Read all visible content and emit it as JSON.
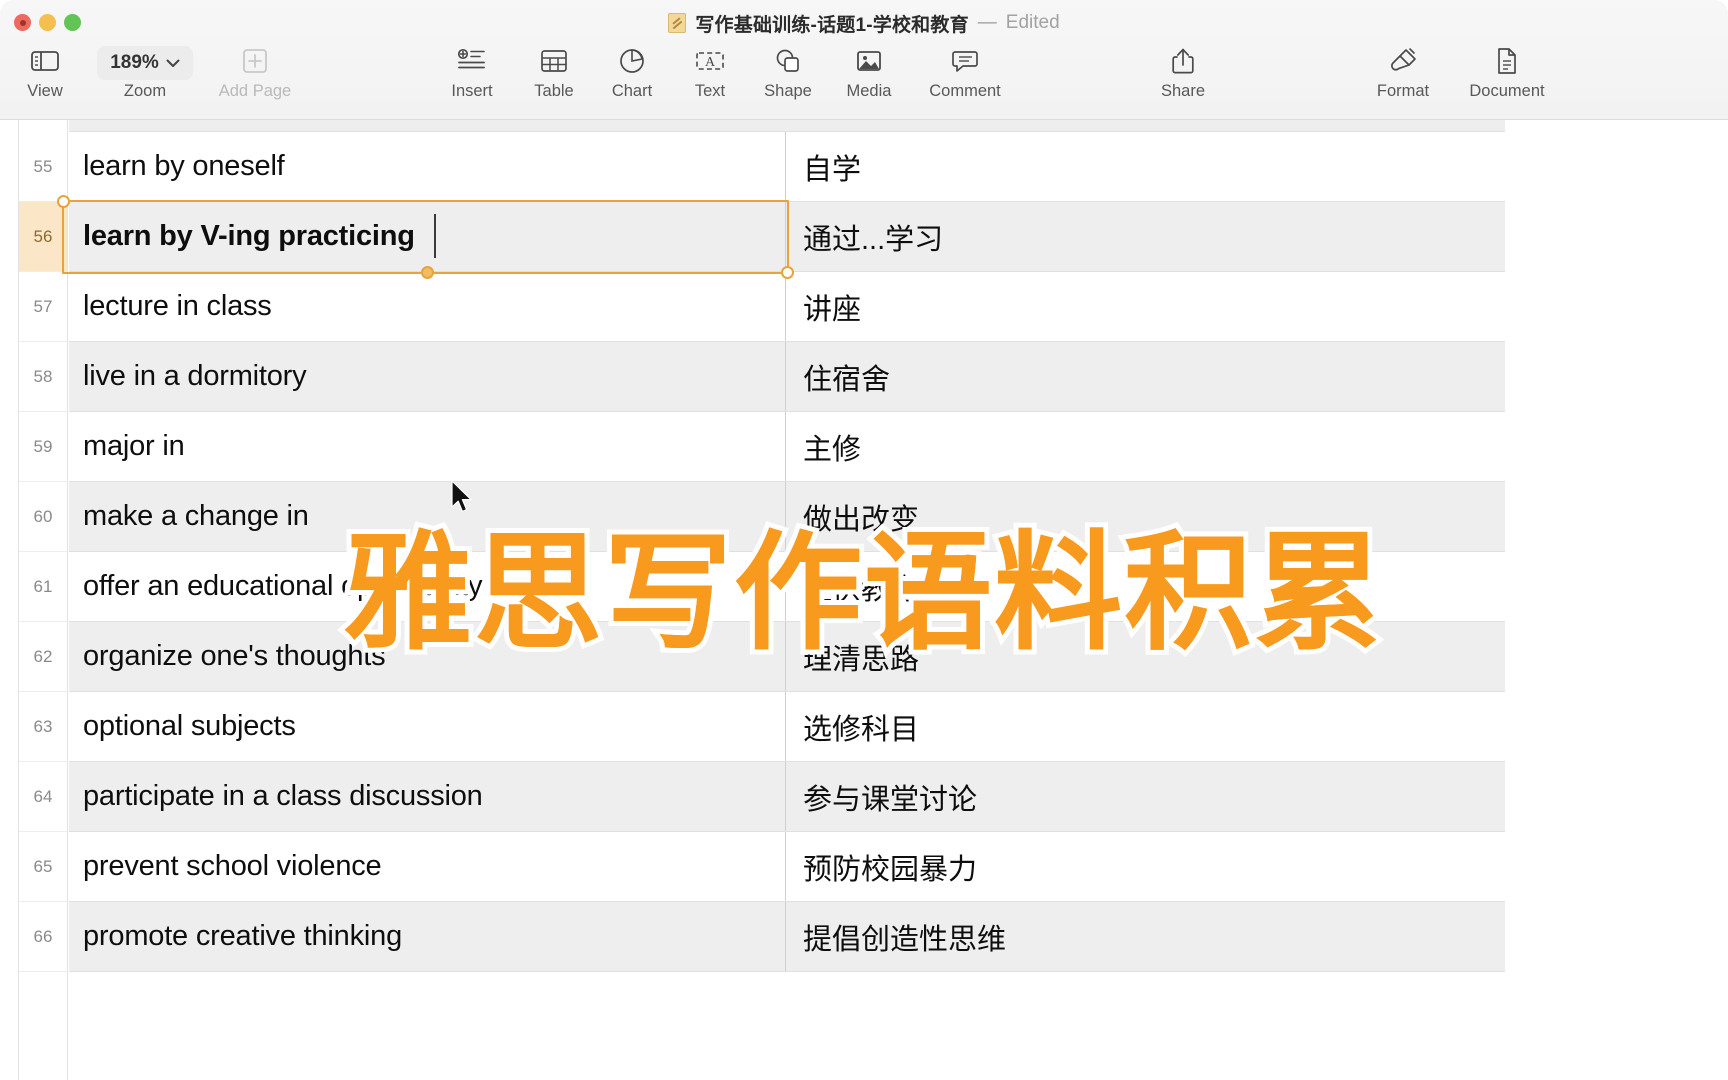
{
  "window": {
    "title": "写作基础训练-话题1-学校和教育",
    "separator": "—",
    "edited_label": "Edited",
    "traffic_lights": [
      "close-button",
      "minimize-button",
      "maximize-button"
    ]
  },
  "toolbar": {
    "items": [
      {
        "label": "View",
        "icon": "sidebar-icon",
        "disabled": false
      },
      {
        "label": "Zoom",
        "icon": "zoom-pill",
        "disabled": false
      },
      {
        "label": "Add Page",
        "icon": "add-page-icon",
        "disabled": true
      },
      {
        "label": "Insert",
        "icon": "insert-icon",
        "disabled": false
      },
      {
        "label": "Table",
        "icon": "table-icon",
        "disabled": false
      },
      {
        "label": "Chart",
        "icon": "chart-icon",
        "disabled": false
      },
      {
        "label": "Text",
        "icon": "text-icon",
        "disabled": false
      },
      {
        "label": "Shape",
        "icon": "shape-icon",
        "disabled": false
      },
      {
        "label": "Media",
        "icon": "media-icon",
        "disabled": false
      },
      {
        "label": "Comment",
        "icon": "comment-icon",
        "disabled": false
      },
      {
        "label": "Share",
        "icon": "share-icon",
        "disabled": false
      },
      {
        "label": "Format",
        "icon": "format-icon",
        "disabled": false
      },
      {
        "label": "Document",
        "icon": "document-icon",
        "disabled": false
      }
    ],
    "zoom_value": "189%"
  },
  "document": {
    "selected_row_number": "56",
    "rows": [
      {
        "num": "55",
        "en": "learn by oneself",
        "zh": "自学"
      },
      {
        "num": "56",
        "en": "learn by V-ing practicing",
        "zh": "通过...学习"
      },
      {
        "num": "57",
        "en": "lecture in class",
        "zh": "讲座"
      },
      {
        "num": "58",
        "en": "live in a dormitory",
        "zh": "住宿舍"
      },
      {
        "num": "59",
        "en": "major in",
        "zh": "主修"
      },
      {
        "num": "60",
        "en": "make a change in",
        "zh": "做出改变"
      },
      {
        "num": "61",
        "en": "offer an educational opportunity",
        "zh": "提供教育机会"
      },
      {
        "num": "62",
        "en": "organize one's thoughts",
        "zh": "理清思路"
      },
      {
        "num": "63",
        "en": "optional subjects",
        "zh": "选修科目"
      },
      {
        "num": "64",
        "en": "participate in a class discussion",
        "zh": "参与课堂讨论"
      },
      {
        "num": "65",
        "en": "prevent school violence",
        "zh": "预防校园暴力"
      },
      {
        "num": "66",
        "en": "promote creative thinking",
        "zh": "提倡创造性思维"
      }
    ]
  },
  "overlay": {
    "watermark_text": "雅思写作语料积累",
    "watermark_color": "#f79a1e",
    "watermark_stroke": "#ffffff"
  },
  "colors": {
    "selection_orange": "#e8a33d",
    "gutter_selected_bg": "#fbe7c7",
    "row_alt_bg": "#eeeeee",
    "toolbar_bg": "#f4f4f4"
  }
}
